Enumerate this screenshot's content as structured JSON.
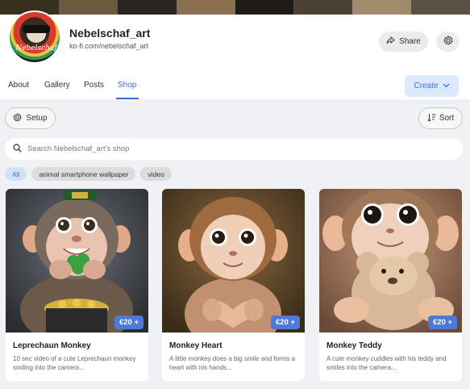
{
  "creator": {
    "name": "Nebelschaf_art",
    "url": "ko-fi.com/nebelschaf_art",
    "avatar_text": "Nebelschaf"
  },
  "header_actions": {
    "share_label": "Share",
    "share_icon": "share-arrow-icon",
    "settings_icon": "gear-icon"
  },
  "tabs": [
    {
      "label": "About",
      "active": false
    },
    {
      "label": "Gallery",
      "active": false
    },
    {
      "label": "Posts",
      "active": false
    },
    {
      "label": "Shop",
      "active": true
    }
  ],
  "create": {
    "label": "Create",
    "icon": "chevron-down-icon"
  },
  "toolbar": {
    "setup_label": "Setup",
    "setup_icon": "gear-icon",
    "sort_label": "Sort",
    "sort_icon": "sort-icon"
  },
  "search": {
    "placeholder": "Search Nebelschaf_art's shop",
    "icon": "search-icon"
  },
  "filters": [
    {
      "label": "All",
      "active": true
    },
    {
      "label": "animal smartphone wallpaper",
      "active": false
    },
    {
      "label": "video",
      "active": false
    }
  ],
  "products": [
    {
      "title": "Leprechaun Monkey",
      "price": "€20 +",
      "description": "10 sec video of a cute Leprechaun monkey smiling into the camera..."
    },
    {
      "title": "Monkey Heart",
      "price": "€20 +",
      "description": "A little monkey does a big smile and forms a heart with his hands..."
    },
    {
      "title": "Monkey Teddy",
      "price": "€20 +",
      "description": "A cute monkey cuddles with his teddy and smiles into the camera..."
    }
  ],
  "colors": {
    "accent": "#3b6fd8",
    "price_badge": "#4f79d6",
    "shop_background": "#eff1f4"
  }
}
